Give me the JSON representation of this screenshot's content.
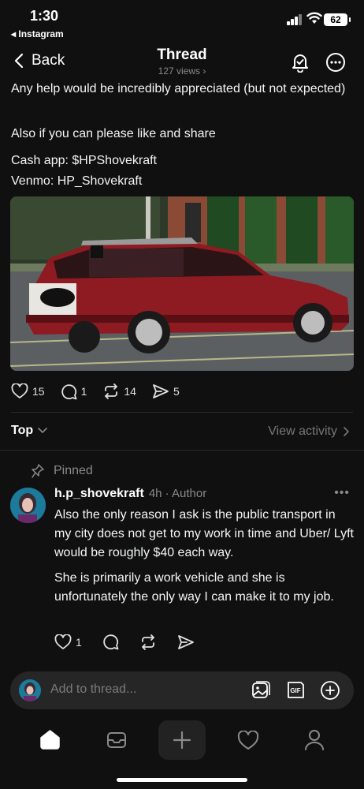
{
  "status_bar": {
    "time": "1:30",
    "back_app": "◂ Instagram",
    "battery": "62"
  },
  "nav": {
    "back_label": "Back",
    "title": "Thread",
    "views": "127 views ›"
  },
  "post": {
    "line1": "Any help would be incredibly appreciated (but not expected)",
    "line2": "Also if you can please like and share",
    "line3": "Cash app: $HPShovekraft",
    "line4": "Venmo:  HP_Shovekraft"
  },
  "post_actions": {
    "likes": "15",
    "replies": "1",
    "reposts": "14",
    "shares": "5"
  },
  "sort": {
    "label": "Top",
    "view_activity": "View activity"
  },
  "reply": {
    "pinned_label": "Pinned",
    "username": "h.p_shovekraft",
    "meta": "4h · Author",
    "more": "•••",
    "para1": "Also the only reason I ask is the public transport in my city does not get to my work in time and Uber/ Lyft would be roughly $40 each way.",
    "para2": "She is primarily a work vehicle and she is unfortunately the only way I can make it to my job.",
    "likes": "1"
  },
  "composer": {
    "placeholder": "Add to thread..."
  },
  "icons": [
    "chevron-left-icon",
    "bell-check-icon",
    "more-icon",
    "heart-icon",
    "comment-icon",
    "repost-icon",
    "send-icon",
    "pin-icon",
    "image-icon",
    "gif-icon",
    "add-icon",
    "home-icon",
    "inbox-icon",
    "plus-icon",
    "activity-heart-icon",
    "profile-icon"
  ],
  "colors": {
    "background": "#101010",
    "text": "#f3f5f7",
    "muted": "#8a8a8a",
    "composer_bg": "#262626",
    "car_red": "#8e1a22"
  }
}
